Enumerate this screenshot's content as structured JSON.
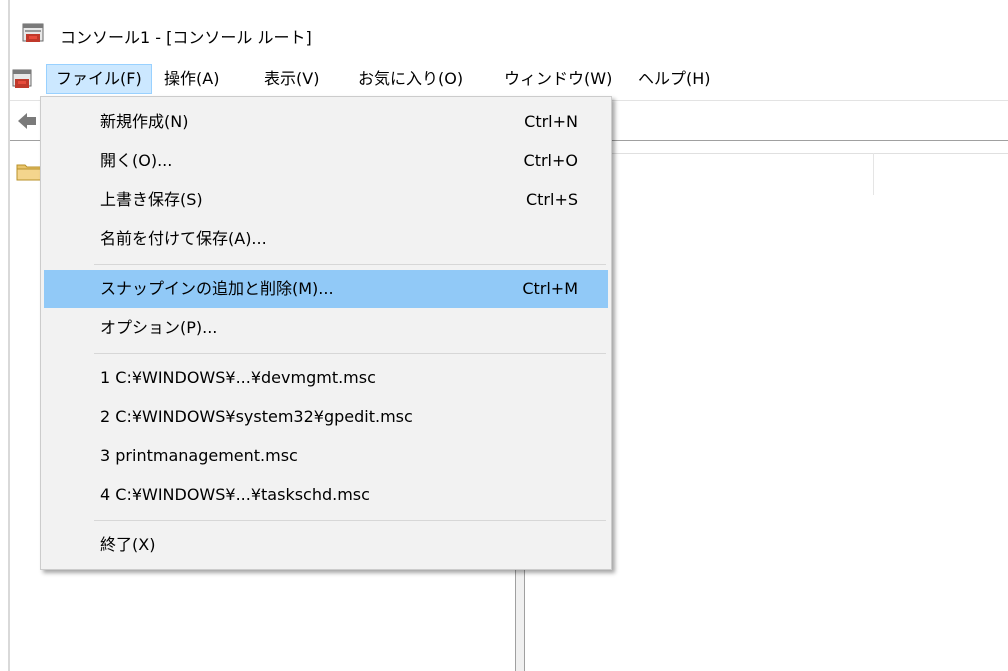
{
  "window": {
    "title": "コンソール1 - [コンソール ルート]"
  },
  "menubar": {
    "items": [
      {
        "label": "ファイル(F)"
      },
      {
        "label": "操作(A)"
      },
      {
        "label": "表示(V)"
      },
      {
        "label": "お気に入り(O)"
      },
      {
        "label": "ウィンドウ(W)"
      },
      {
        "label": "ヘルプ(H)"
      }
    ]
  },
  "file_menu": {
    "items": [
      {
        "label": "新規作成(N)",
        "shortcut": "Ctrl+N"
      },
      {
        "label": "開く(O)...",
        "shortcut": "Ctrl+O"
      },
      {
        "label": "上書き保存(S)",
        "shortcut": "Ctrl+S"
      },
      {
        "label": "名前を付けて保存(A)...",
        "shortcut": ""
      },
      {
        "label": "スナップインの追加と削除(M)...",
        "shortcut": "Ctrl+M",
        "highlighted": true
      },
      {
        "label": "オプション(P)...",
        "shortcut": ""
      },
      {
        "label": "1 C:¥WINDOWS¥...¥devmgmt.msc",
        "shortcut": ""
      },
      {
        "label": "2 C:¥WINDOWS¥system32¥gpedit.msc",
        "shortcut": ""
      },
      {
        "label": "3 printmanagement.msc",
        "shortcut": ""
      },
      {
        "label": "4 C:¥WINDOWS¥...¥taskschd.msc",
        "shortcut": ""
      },
      {
        "label": "終了(X)",
        "shortcut": ""
      }
    ]
  },
  "icons": {
    "app": "mmc-console-icon",
    "back": "back-arrow-icon",
    "tree_root": "folder-icon"
  },
  "colors": {
    "menu_background": "#f2f2f2",
    "highlight": "#91c9f7",
    "active_menubar": "#cce8ff"
  }
}
